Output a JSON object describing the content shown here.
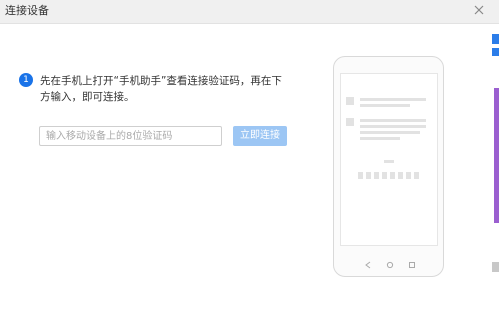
{
  "window": {
    "title": "连接设备",
    "close_icon": "close-icon"
  },
  "step": {
    "number": "1",
    "instruction": "先在手机上打开“手机助手”查看连接验证码，再在下方输入，即可连接。"
  },
  "form": {
    "code_input": {
      "value": "",
      "placeholder": "输入移动设备上的8位验证码"
    },
    "connect_button": "立即连接"
  },
  "phone_illustration": {
    "nav_icons": [
      "back-icon",
      "home-icon",
      "recent-apps-icon"
    ]
  },
  "colors": {
    "accent": "#1a73e8",
    "button_disabled": "#9cc6f4"
  }
}
